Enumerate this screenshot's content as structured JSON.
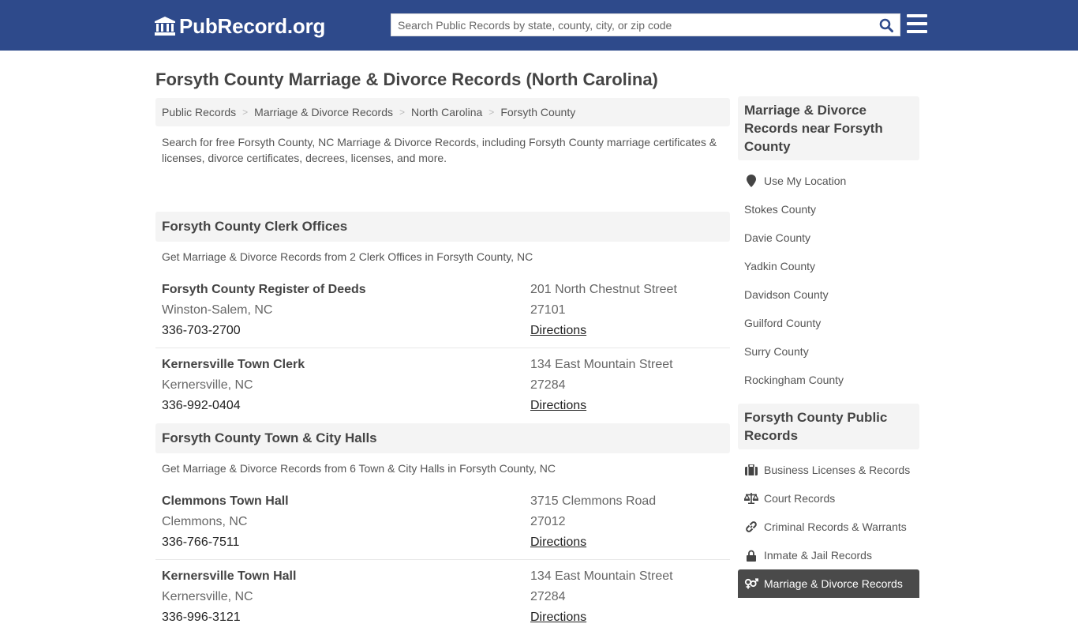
{
  "header": {
    "logo_text": "PubRecord.org",
    "search_placeholder": "Search Public Records by state, county, city, or zip code",
    "brand_color": "#2e4a8b"
  },
  "page_title": "Forsyth County Marriage & Divorce Records (North Carolina)",
  "breadcrumb": [
    {
      "label": "Public Records"
    },
    {
      "label": "Marriage & Divorce Records"
    },
    {
      "label": "North Carolina"
    },
    {
      "label": "Forsyth County"
    }
  ],
  "intro": "Search for free Forsyth County, NC Marriage & Divorce Records, including Forsyth County marriage certificates & licenses, divorce certificates, decrees, licenses, and more.",
  "sections": [
    {
      "title": "Forsyth County Clerk Offices",
      "subtitle": "Get Marriage & Divorce Records from 2 Clerk Offices in Forsyth County, NC",
      "listings": [
        {
          "name": "Forsyth County Register of Deeds",
          "city": "Winston-Salem, NC",
          "phone": "336-703-2700",
          "address": "201 North Chestnut Street",
          "zip": "27101",
          "directions": "Directions"
        },
        {
          "name": "Kernersville Town Clerk",
          "city": "Kernersville, NC",
          "phone": "336-992-0404",
          "address": "134 East Mountain Street",
          "zip": "27284",
          "directions": "Directions"
        }
      ]
    },
    {
      "title": "Forsyth County Town & City Halls",
      "subtitle": "Get Marriage & Divorce Records from 6 Town & City Halls in Forsyth County, NC",
      "listings": [
        {
          "name": "Clemmons Town Hall",
          "city": "Clemmons, NC",
          "phone": "336-766-7511",
          "address": "3715 Clemmons Road",
          "zip": "27012",
          "directions": "Directions"
        },
        {
          "name": "Kernersville Town Hall",
          "city": "Kernersville, NC",
          "phone": "336-996-3121",
          "address": "134 East Mountain Street",
          "zip": "27284",
          "directions": "Directions"
        }
      ]
    }
  ],
  "sidebar": {
    "nearby": {
      "title": "Marriage & Divorce Records near Forsyth County",
      "use_location": "Use My Location",
      "counties": [
        "Stokes County",
        "Davie County",
        "Yadkin County",
        "Davidson County",
        "Guilford County",
        "Surry County",
        "Rockingham County"
      ]
    },
    "public_records": {
      "title": "Forsyth County Public Records",
      "items": [
        {
          "label": "Business Licenses & Records",
          "icon": "briefcase-icon"
        },
        {
          "label": "Court Records",
          "icon": "balance-scale-icon"
        },
        {
          "label": "Criminal Records & Warrants",
          "icon": "link-icon"
        },
        {
          "label": "Inmate & Jail Records",
          "icon": "lock-icon"
        },
        {
          "label": "Marriage & Divorce Records",
          "icon": "gender-icon",
          "active": true
        }
      ]
    }
  }
}
